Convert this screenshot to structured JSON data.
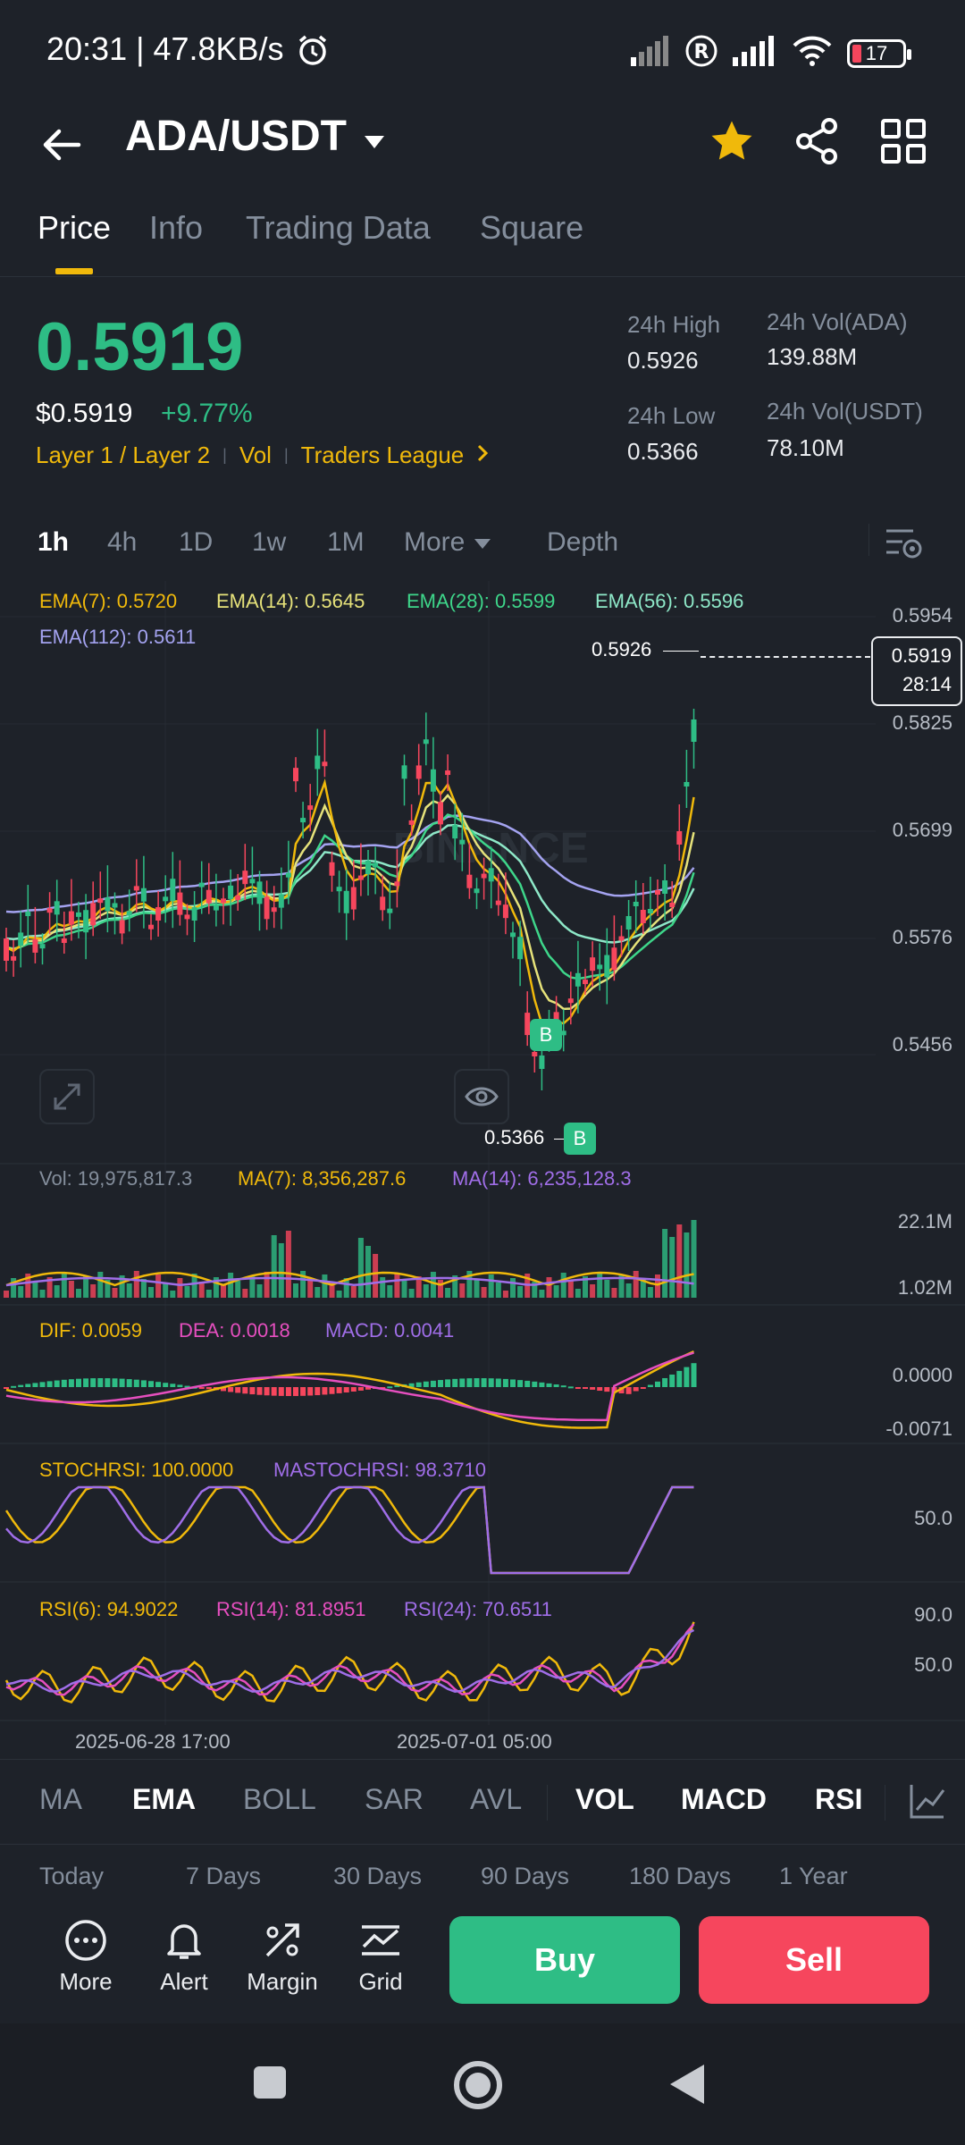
{
  "status_bar": {
    "time": "20:31 | 47.8KB/s",
    "battery": "17"
  },
  "header": {
    "pair": "ADA/USDT"
  },
  "tabs": [
    {
      "label": "Price"
    },
    {
      "label": "Info"
    },
    {
      "label": "Trading Data"
    },
    {
      "label": "Square"
    }
  ],
  "ticker": {
    "last_price": "0.5919",
    "usd_price": "$0.5919",
    "change": "+9.77%",
    "tags": [
      "Layer 1 / Layer 2",
      "Vol",
      "Traders League"
    ],
    "high_label": "24h High",
    "high_value": "0.5926",
    "low_label": "24h Low",
    "low_value": "0.5366",
    "vol_base_label": "24h Vol(ADA)",
    "vol_base_value": "139.88M",
    "vol_quote_label": "24h Vol(USDT)",
    "vol_quote_value": "78.10M"
  },
  "intervals": [
    "1h",
    "4h",
    "1D",
    "1w",
    "1M",
    "More",
    "Depth"
  ],
  "chart": {
    "ema_labels": [
      "EMA(7): 0.5720",
      "EMA(14): 0.5645",
      "EMA(28): 0.5599",
      "EMA(56): 0.5596",
      "EMA(112): 0.5611"
    ],
    "price_axis": [
      "0.5954",
      "0.5825",
      "0.5699",
      "0.5576",
      "0.5456"
    ],
    "high_marker": "0.5926",
    "low_marker": "0.5366",
    "current_price": "0.5919",
    "countdown": "28:14",
    "buy_marker": "B",
    "watermark": "BINANCE",
    "vol_labels": [
      "Vol: 19,975,817.3",
      "MA(7): 8,356,287.6",
      "MA(14): 6,235,128.3"
    ],
    "vol_axis": [
      "22.1M",
      "1.02M"
    ],
    "macd_labels": [
      "DIF: 0.0059",
      "DEA: 0.0018",
      "MACD: 0.0041"
    ],
    "macd_axis": [
      "0.0000",
      "-0.0071"
    ],
    "stoch_labels": [
      "STOCHRSI: 100.0000",
      "MASTOCHRSI: 98.3710"
    ],
    "stoch_axis": [
      "50.0"
    ],
    "rsi_labels": [
      "RSI(6): 94.9022",
      "RSI(14): 81.8951",
      "RSI(24): 70.6511"
    ],
    "rsi_axis": [
      "90.0",
      "50.0"
    ],
    "time_labels": [
      "2025-06-28 17:00",
      "2025-07-01 05:00"
    ],
    "colors": {
      "up": "#2ebd85",
      "down": "#f6465d",
      "ema7": "#f0b90b",
      "ema14": "#e6e27a",
      "ema28": "#3ed68a",
      "ema56": "#8ee8c8",
      "ema112": "#a4a3f0",
      "pink": "#e64fbf",
      "purple": "#a06ee8"
    }
  },
  "chart_data": {
    "type": "candlestick",
    "series": [
      {
        "name": "EMA(7)",
        "last": 0.572
      },
      {
        "name": "EMA(14)",
        "last": 0.5645
      },
      {
        "name": "EMA(28)",
        "last": 0.5599
      },
      {
        "name": "EMA(56)",
        "last": 0.5596
      },
      {
        "name": "EMA(112)",
        "last": 0.5611
      }
    ],
    "ylim": [
      0.5456,
      0.5954
    ],
    "high": 0.5926,
    "low": 0.5366,
    "last": 0.5919
  },
  "indicators": [
    "MA",
    "EMA",
    "BOLL",
    "SAR",
    "AVL",
    "VOL",
    "MACD",
    "RSI"
  ],
  "ranges": [
    "Today",
    "7 Days",
    "30 Days",
    "90 Days",
    "180 Days",
    "1 Year"
  ],
  "actions": [
    {
      "label": "More"
    },
    {
      "label": "Alert"
    },
    {
      "label": "Margin"
    },
    {
      "label": "Grid"
    }
  ],
  "buy_label": "Buy",
  "sell_label": "Sell"
}
